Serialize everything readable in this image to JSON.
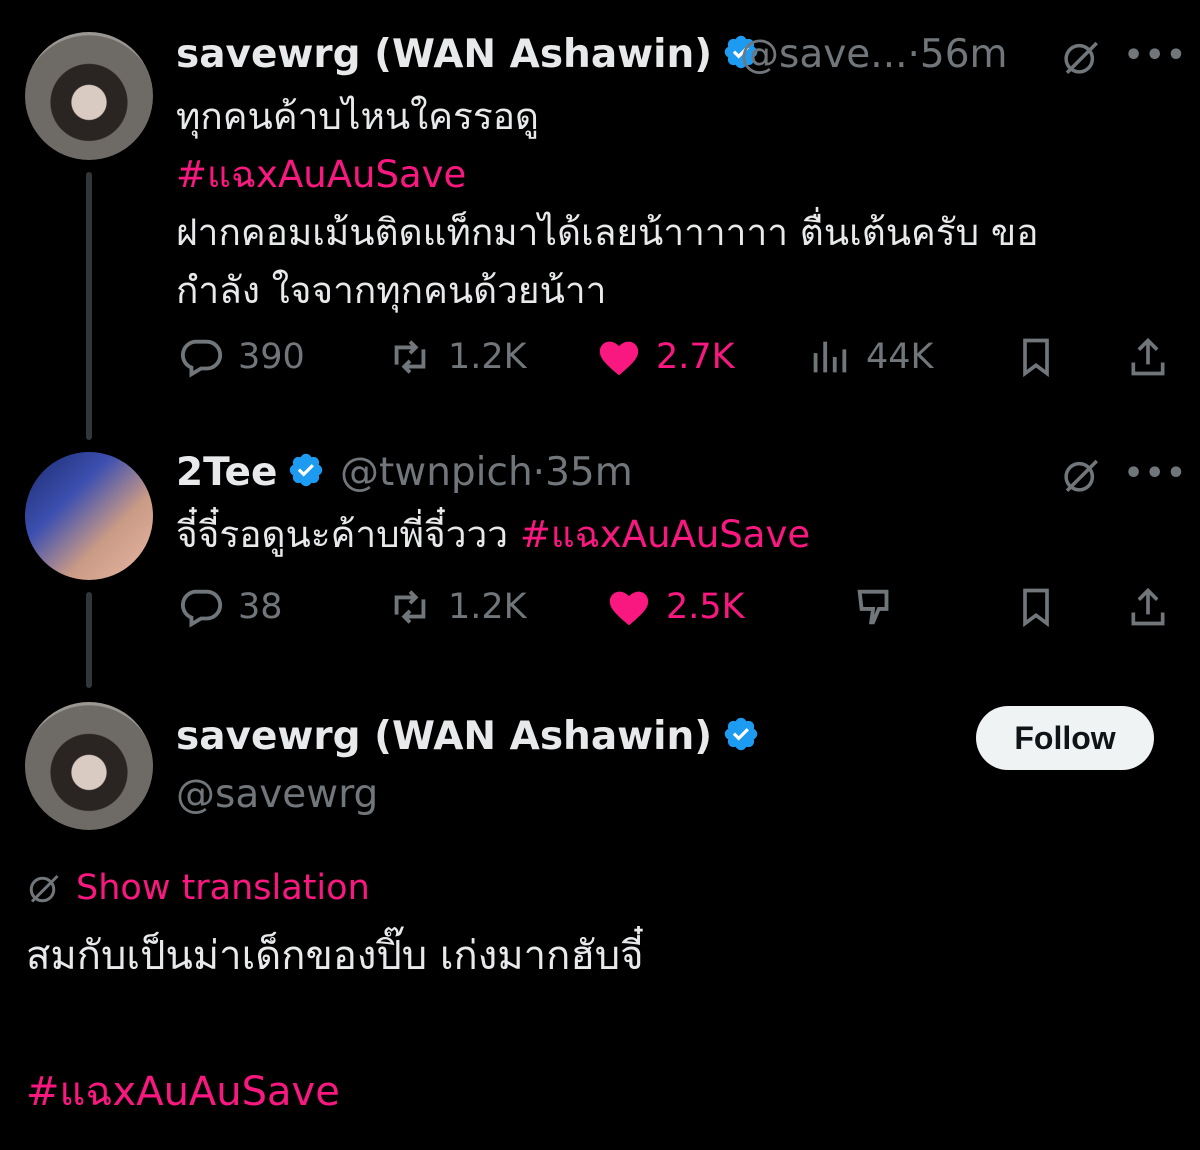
{
  "tweet1": {
    "name": "savewrg (WAN Ashawin)",
    "handle": "@save...",
    "sep": "·",
    "time": "56m",
    "line1": "ทุกคนค้าบไหนใครรอดู",
    "hashtag": "#แฉxAuAuSave",
    "line3": "ฝากคอมเม้นติดแท็กมาได้เลยน้าาาาาา ตื่นเต้นครับ ขอ",
    "line4": "กำลัง ใจจากทุกคนด้วยน้าา",
    "replies": "390",
    "retweets": "1.2K",
    "likes": "2.7K",
    "views": "44K"
  },
  "tweet2": {
    "name": "2Tee",
    "handle": "@twnpich",
    "sep": "·",
    "time": "35m",
    "text": "จี๋จี๋รอดูนะค้าบพี่จี๋ววว",
    "hashtag": "#แฉxAuAuSave",
    "replies": "38",
    "retweets": "1.2K",
    "likes": "2.5K"
  },
  "main": {
    "name": "savewrg (WAN Ashawin)",
    "handle": "@savewrg",
    "follow_label": "Follow",
    "show_translation": "Show translation",
    "text": "สมกับเป็นม่าเด็กของปิ๊บ เก่งมากฮับจี๋",
    "hashtag": "#แฉxAuAuSave"
  },
  "more_label": "•••",
  "colors": {
    "accent": "#f91880",
    "verified": "#1d9bf0",
    "muted": "#71767b",
    "background": "#000000"
  }
}
